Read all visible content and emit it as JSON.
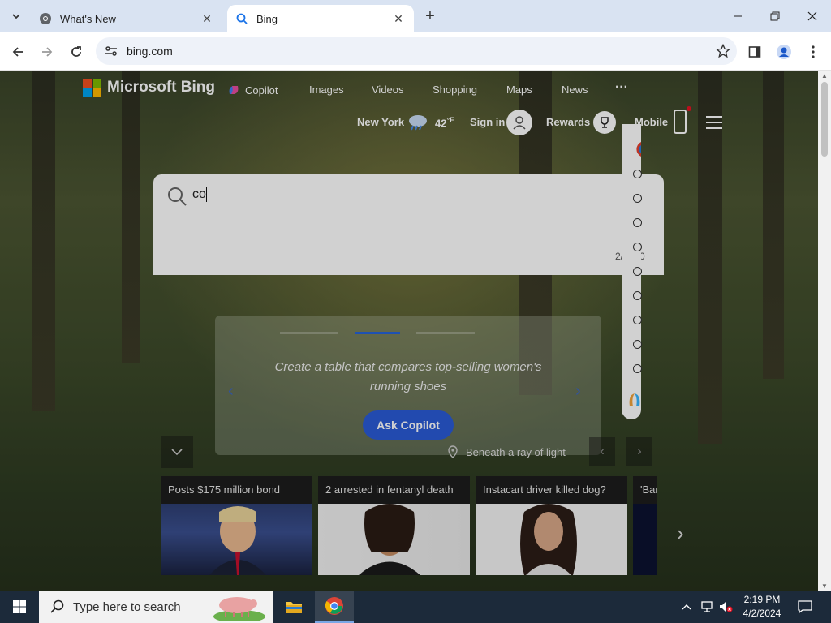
{
  "browser": {
    "tabs": [
      {
        "title": "What's New",
        "active": false
      },
      {
        "title": "Bing",
        "active": true
      }
    ],
    "url": "bing.com"
  },
  "bing": {
    "brand": "Microsoft Bing",
    "nav": [
      "Copilot",
      "Images",
      "Videos",
      "Shopping",
      "Maps",
      "News"
    ],
    "more": "···",
    "location": "New York",
    "temperature": "42",
    "temp_unit": "°F",
    "sign_in": "Sign in",
    "rewards": "Rewards",
    "mobile": "Mobile",
    "search_query": "co",
    "char_counter": "2/2000",
    "carousel": {
      "prompt": "Create a table that compares top-selling women's running shoes",
      "button": "Ask Copilot"
    },
    "image_location": "Beneath a ray of light",
    "news": [
      {
        "title": "Posts $175 million bond"
      },
      {
        "title": "2 arrested in fentanyl death"
      },
      {
        "title": "Instacart driver killed dog?"
      },
      {
        "title": "'Bar"
      }
    ]
  },
  "taskbar": {
    "search_placeholder": "Type here to search",
    "time": "2:19 PM",
    "date": "4/2/2024"
  },
  "colors": {
    "accent_blue": "#2a5bd6",
    "tab_strip": "#d9e3f2",
    "taskbar": "#1c2a3a"
  }
}
